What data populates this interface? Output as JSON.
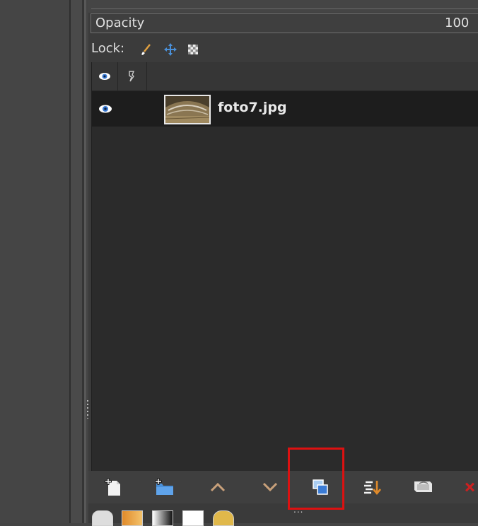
{
  "opacity": {
    "label": "Opacity",
    "value": "100"
  },
  "lock": {
    "label": "Lock:",
    "icons": [
      "paintbrush-icon",
      "move-icon",
      "checkerboard-icon"
    ]
  },
  "list_header": {
    "icons": [
      "eye-icon",
      "chain-icon"
    ]
  },
  "layers": [
    {
      "name": "foto7.jpg",
      "visible": true
    }
  ],
  "toolbar": {
    "buttons": [
      "new-layer-icon",
      "new-layer-group-icon",
      "raise-layer-icon",
      "lower-layer-icon",
      "duplicate-layer-icon",
      "anchor-merge-icon",
      "mask-icon",
      "delete-layer-icon"
    ],
    "highlighted_button": "duplicate-layer-icon"
  },
  "colors": {
    "accent_blue": "#4a90d9",
    "highlight_red": "#dd1111",
    "arrow_tan": "#c8a07a"
  }
}
